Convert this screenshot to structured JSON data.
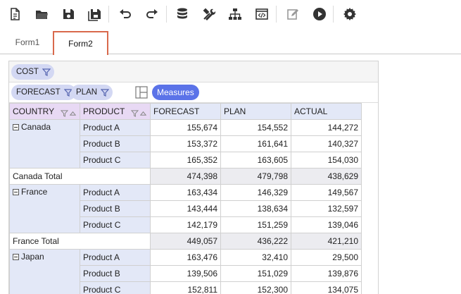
{
  "toolbar": {
    "buttons": [
      {
        "id": "new",
        "icon": "new-document-icon"
      },
      {
        "id": "open",
        "icon": "open-folder-icon"
      },
      {
        "id": "save",
        "icon": "save-icon"
      },
      {
        "id": "save-as",
        "icon": "save-as-icon"
      },
      {
        "id": "undo",
        "icon": "undo-icon"
      },
      {
        "id": "redo",
        "icon": "redo-icon"
      },
      {
        "id": "datasource",
        "icon": "database-icon"
      },
      {
        "id": "tools",
        "icon": "tools-icon"
      },
      {
        "id": "hierarchy",
        "icon": "hierarchy-icon"
      },
      {
        "id": "code",
        "icon": "code-icon"
      },
      {
        "id": "edit",
        "icon": "edit-icon"
      },
      {
        "id": "run",
        "icon": "play-icon"
      },
      {
        "id": "settings",
        "icon": "gear-icon"
      }
    ]
  },
  "tabs": [
    {
      "label": "Form1",
      "active": false
    },
    {
      "label": "Form2",
      "active": true
    }
  ],
  "pivot": {
    "filter_fields": [
      "COST"
    ],
    "column_fields": [
      "FORECAST",
      "PLAN"
    ],
    "measures_label": "Measures",
    "row_headers": [
      "COUNTRY",
      "PRODUCT"
    ],
    "measure_headers": [
      "FORECAST",
      "PLAN",
      "ACTUAL"
    ],
    "groups": [
      {
        "country": "Canada",
        "rows": [
          {
            "product": "Product A",
            "values": [
              "155,674",
              "154,552",
              "144,272"
            ]
          },
          {
            "product": "Product B",
            "values": [
              "153,372",
              "161,641",
              "140,327"
            ]
          },
          {
            "product": "Product C",
            "values": [
              "165,352",
              "163,605",
              "154,030"
            ]
          }
        ],
        "total_label": "Canada Total",
        "total": [
          "474,398",
          "479,798",
          "438,629"
        ]
      },
      {
        "country": "France",
        "rows": [
          {
            "product": "Product A",
            "values": [
              "163,434",
              "146,329",
              "149,567"
            ]
          },
          {
            "product": "Product B",
            "values": [
              "143,444",
              "138,634",
              "132,597"
            ]
          },
          {
            "product": "Product C",
            "values": [
              "142,179",
              "151,259",
              "139,046"
            ]
          }
        ],
        "total_label": "France Total",
        "total": [
          "449,057",
          "436,222",
          "421,210"
        ]
      },
      {
        "country": "Japan",
        "rows": [
          {
            "product": "Product A",
            "values": [
              "163,476",
              "32,410",
              "29,500"
            ]
          },
          {
            "product": "Product B",
            "values": [
              "139,506",
              "151,029",
              "139,876"
            ]
          },
          {
            "product": "Product C",
            "values": [
              "152,811",
              "152,300",
              "134,075"
            ]
          }
        ]
      }
    ]
  },
  "colors": {
    "accent": "#5b73e8",
    "active_tab_border": "#d9694c",
    "chip_bg": "#d3d8f3",
    "row_header_bg": "#e8d9f4",
    "col_header_bg": "#e3e8f7"
  }
}
